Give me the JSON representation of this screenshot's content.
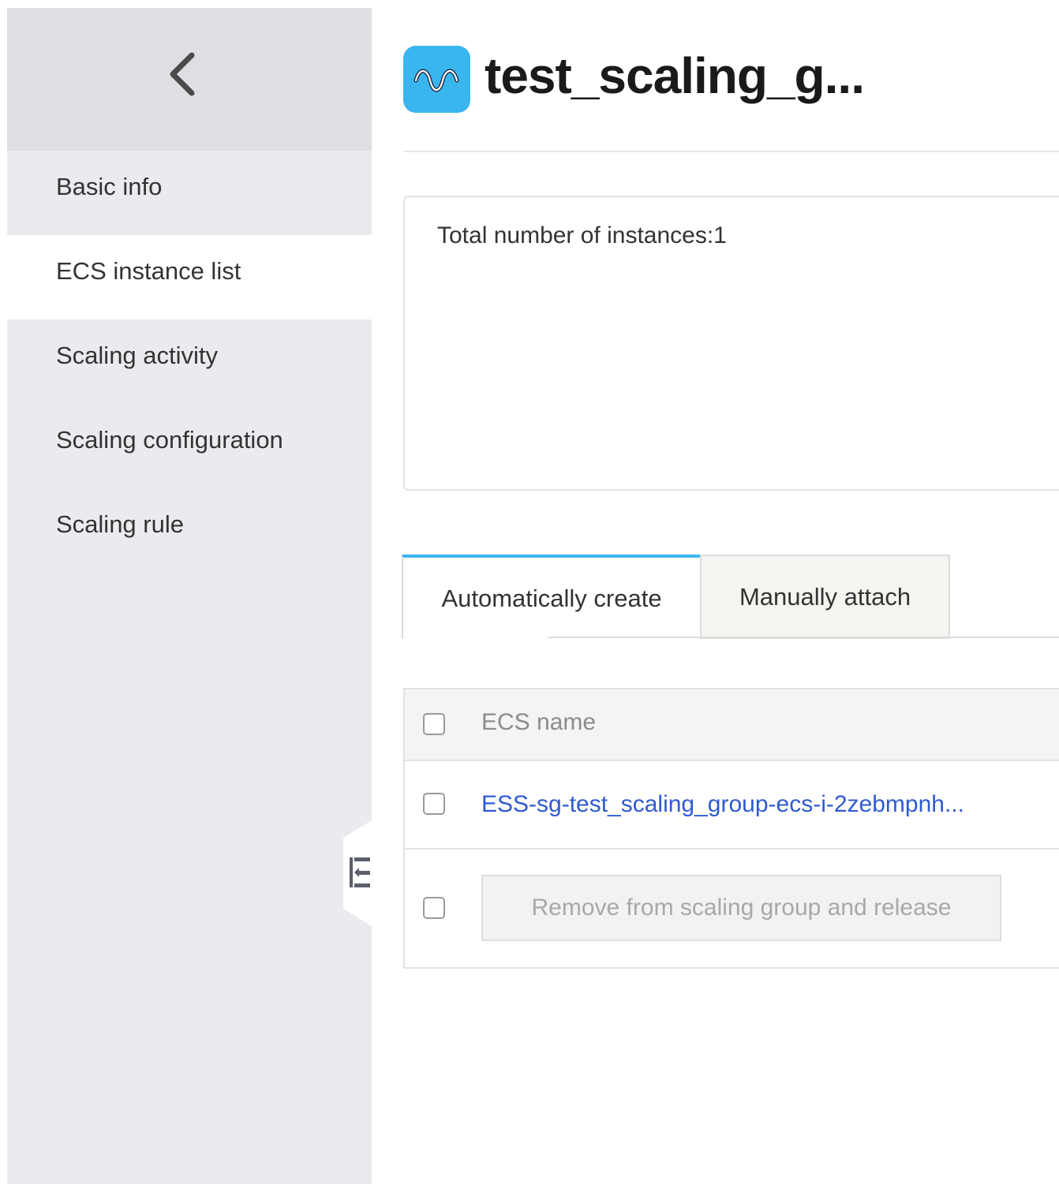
{
  "sidebar": {
    "back_icon": "chevron-left-icon",
    "items": [
      {
        "label": "Basic info",
        "active": false
      },
      {
        "label": "ECS instance list",
        "active": true
      },
      {
        "label": "Scaling activity",
        "active": false
      },
      {
        "label": "Scaling configuration",
        "active": false
      },
      {
        "label": "Scaling rule",
        "active": false
      }
    ],
    "collapse_icon": "collapse-sidebar-icon"
  },
  "header": {
    "app_icon": "auto-scaling-wave-icon",
    "title": "test_scaling_g..."
  },
  "summary": {
    "total_instances_text": "Total number of instances:1"
  },
  "tabs": [
    {
      "label": "Automatically create",
      "active": true
    },
    {
      "label": "Manually attach",
      "active": false
    }
  ],
  "table": {
    "columns": [
      "ECS name"
    ],
    "rows": [
      {
        "ecs_name": "ESS-sg-test_scaling_group-ecs-i-2zebmpnh..."
      }
    ],
    "footer": {
      "remove_button_label": "Remove from scaling group and release",
      "remove_button_enabled": false
    }
  },
  "colors": {
    "accent": "#3ab6ef",
    "link": "#2f5bd3",
    "sidebar_bg": "#ebebef",
    "sidebar_header_bg": "#dedee3"
  }
}
